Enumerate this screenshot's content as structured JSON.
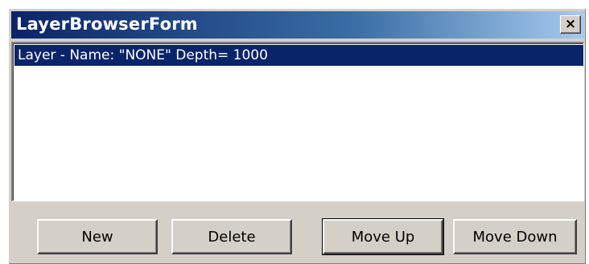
{
  "window": {
    "title": "LayerBrowserForm",
    "close_label": "×"
  },
  "layers": {
    "items": [
      {
        "label": "Layer - Name: \"NONE\" Depth= 1000",
        "selected": true
      }
    ]
  },
  "buttons": {
    "new_label": "New",
    "delete_label": "Delete",
    "move_up_label": "Move Up",
    "move_down_label": "Move Down"
  },
  "colors": {
    "title_start": "#0a246a",
    "title_end": "#a6caf0",
    "selection": "#0a246a",
    "face": "#d4d0c8"
  }
}
